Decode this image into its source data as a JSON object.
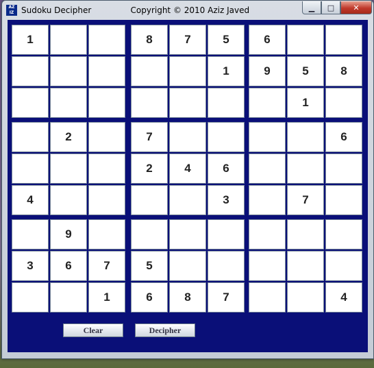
{
  "window": {
    "icon_text": "AZ\nIZ",
    "title": "Sudoku Decipher",
    "copyright": "Copyright © 2010 Aziz Javed",
    "minimize_glyph": "▁",
    "maximize_glyph": "□",
    "close_glyph": "✕"
  },
  "board": {
    "rows": [
      [
        "1",
        "",
        "",
        "8",
        "7",
        "5",
        "6",
        "",
        ""
      ],
      [
        "",
        "",
        "",
        "",
        "",
        "1",
        "9",
        "5",
        "8"
      ],
      [
        "",
        "",
        "",
        "",
        "",
        "",
        "",
        "1",
        ""
      ],
      [
        "",
        "2",
        "",
        "7",
        "",
        "",
        "",
        "",
        "6"
      ],
      [
        "",
        "",
        "",
        "2",
        "4",
        "6",
        "",
        "",
        ""
      ],
      [
        "4",
        "",
        "",
        "",
        "",
        "3",
        "",
        "7",
        ""
      ],
      [
        "",
        "9",
        "",
        "",
        "",
        "",
        "",
        "",
        ""
      ],
      [
        "3",
        "6",
        "7",
        "5",
        "",
        "",
        "",
        "",
        ""
      ],
      [
        "",
        "",
        "1",
        "6",
        "8",
        "7",
        "",
        "",
        "4"
      ]
    ]
  },
  "buttons": {
    "clear": "Clear",
    "decipher": "Decipher"
  }
}
